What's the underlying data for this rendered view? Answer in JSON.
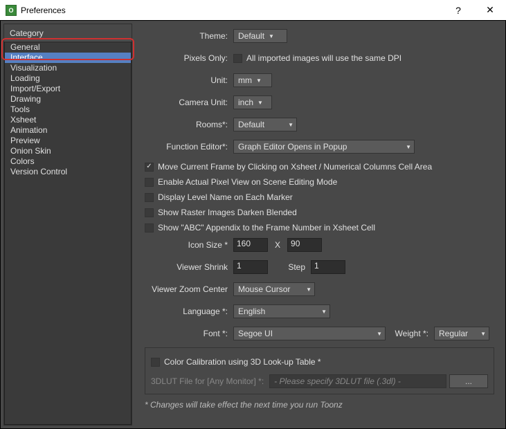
{
  "window": {
    "title": "Preferences"
  },
  "category": {
    "header": "Category",
    "items": [
      "General",
      "Interface",
      "Visualization",
      "Loading",
      "Import/Export",
      "Drawing",
      "Tools",
      "Xsheet",
      "Animation",
      "Preview",
      "Onion Skin",
      "Colors",
      "Version Control"
    ],
    "selected": "Interface"
  },
  "form": {
    "theme_label": "Theme:",
    "theme_value": "Default",
    "pixels_only_label": "Pixels Only:",
    "pixels_only_text": "All imported images will use the same DPI",
    "unit_label": "Unit:",
    "unit_value": "mm",
    "camera_unit_label": "Camera Unit:",
    "camera_unit_value": "inch",
    "rooms_label": "Rooms*:",
    "rooms_value": "Default",
    "func_editor_label": "Function Editor*:",
    "func_editor_value": "Graph Editor Opens in Popup",
    "chk_move_frame": "Move Current Frame by Clicking on Xsheet / Numerical Columns Cell Area",
    "chk_actual_pixel": "Enable Actual Pixel View on Scene Editing Mode",
    "chk_level_name": "Display Level Name on Each Marker",
    "chk_raster_darken": "Show Raster Images Darken Blended",
    "chk_abc_appendix": "Show \"ABC\" Appendix to the Frame Number in Xsheet Cell",
    "icon_size_label": "Icon Size *",
    "icon_size_w": "160",
    "icon_size_x": "X",
    "icon_size_h": "90",
    "viewer_shrink_label": "Viewer Shrink",
    "viewer_shrink_value": "1",
    "step_label": "Step",
    "step_value": "1",
    "viewer_zoom_label": "Viewer Zoom Center",
    "viewer_zoom_value": "Mouse Cursor",
    "language_label": "Language *:",
    "language_value": "English",
    "font_label": "Font *:",
    "font_value": "Segoe UI",
    "weight_label": "Weight *:",
    "weight_value": "Regular",
    "ccal_label": "Color Calibration using 3D Look-up Table *",
    "lut_label": "3DLUT File for [Any Monitor] *:",
    "lut_placeholder": "- Please specify 3DLUT file (.3dl) -",
    "browse": "...",
    "footnote": "* Changes will take effect the next time you run Toonz"
  }
}
